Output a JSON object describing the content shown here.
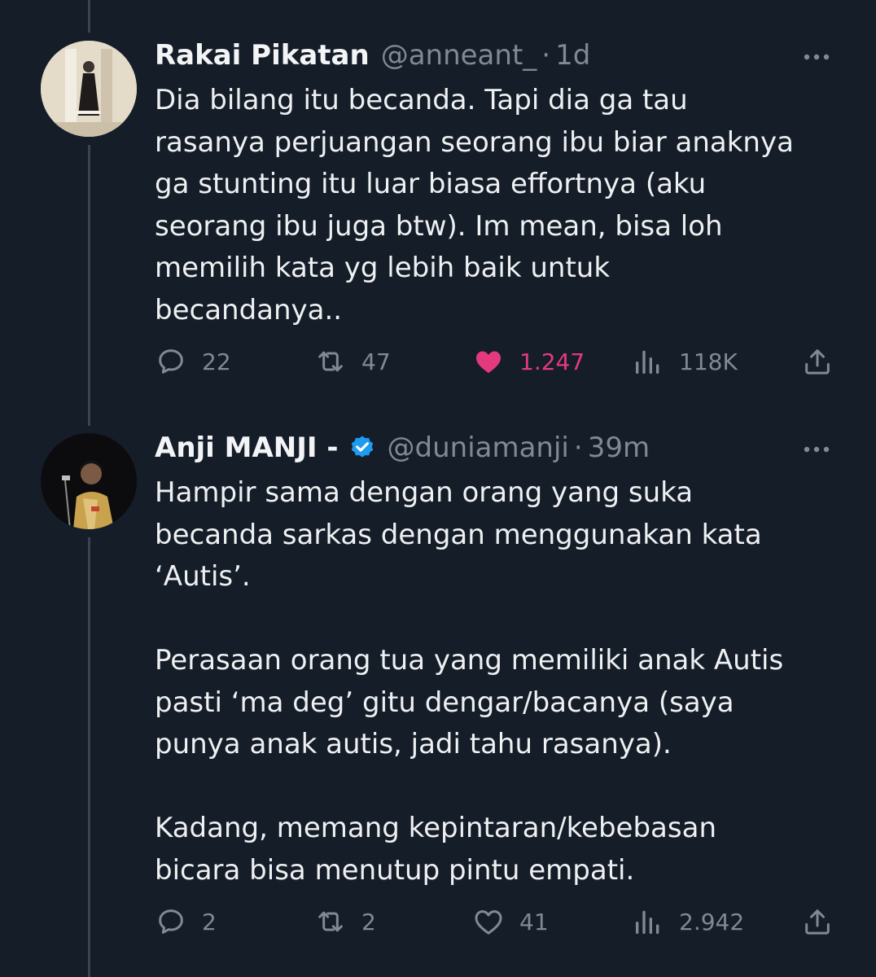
{
  "tweets": [
    {
      "name": "Rakai Pikatan",
      "handle": "@anneant_",
      "separator": "·",
      "time": "1d",
      "verified": false,
      "text": "Dia bilang itu becanda. Tapi dia ga tau\nrasanya perjuangan seorang ibu biar anaknya\nga stunting itu luar biasa effortnya (aku\nseorang ibu juga btw). Im mean, bisa loh\nmemilih kata yg lebih baik untuk\nbecandanya..",
      "replies": "22",
      "retweets": "47",
      "likes": "1.247",
      "liked": true,
      "views": "118K"
    },
    {
      "name": "Anji MANJI -",
      "handle": "@duniamanji",
      "separator": "·",
      "time": "39m",
      "verified": true,
      "text": "Hampir sama dengan orang yang suka\nbecanda sarkas dengan menggunakan kata\n‘Autis’.\n\nPerasaan orang tua yang memiliki anak Autis\npasti ‘ma deg’ gitu dengar/bacanya (saya\npunya anak autis, jadi tahu rasanya).\n\nKadang, memang kepintaran/kebebasan\nbicara bisa menutup pintu empati.",
      "replies": "2",
      "retweets": "2",
      "likes": "41",
      "liked": false,
      "views": "2.942"
    }
  ],
  "colors": {
    "background": "#151d28",
    "muted": "#7f8a96",
    "like_active": "#e5397e",
    "verified": "#1d9bf0"
  },
  "icons": [
    "reply-icon",
    "retweet-icon",
    "like-icon",
    "views-icon",
    "share-icon",
    "more-icon",
    "verified-badge-icon"
  ]
}
